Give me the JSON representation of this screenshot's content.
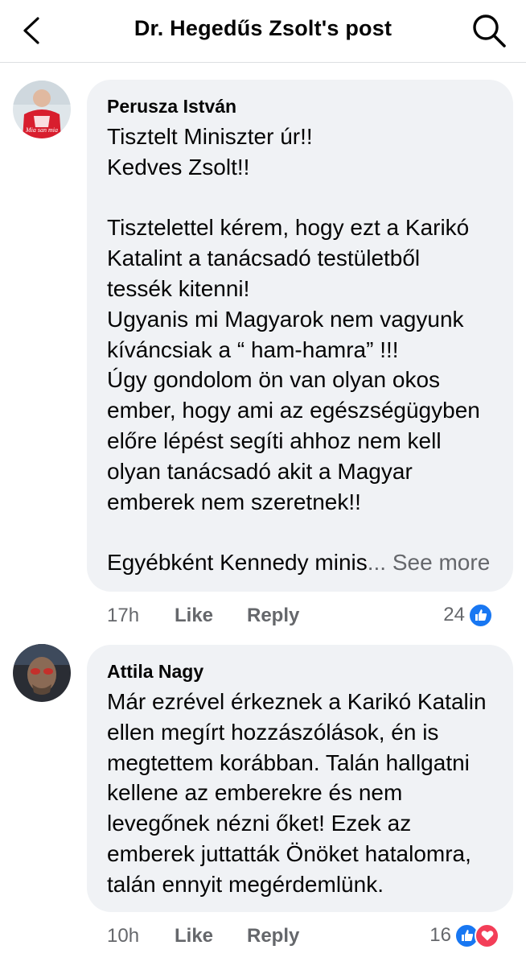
{
  "header": {
    "title": "Dr. Hegedűs Zsolt's post"
  },
  "comments": [
    {
      "author": "Perusza István",
      "text": "Tisztelt Miniszter úr!!\nKedves Zsolt!!\n\nTisztelettel kérem, hogy ezt a Karikó\nKatalint a tanácsadó testületből\ntessék kitenni!\nUgyanis mi Magyarok nem vagyunk\nkíváncsiak a “ ham-hamra” !!!\nÚgy gondolom ön van olyan okos\nember, hogy ami az egészségügyben\nelőre lépést segíti ahhoz nem kell\nolyan tanácsadó akit a Magyar\nemberek nem szeretnek!!\n\nEgyébként Kennedy minis",
      "ellipsis": "...",
      "see_more": "See more",
      "time": "17h",
      "like_label": "Like",
      "reply_label": "Reply",
      "reaction_count": "24",
      "reactions": [
        "like-icon"
      ],
      "avatar_caption": "Mia san mia"
    },
    {
      "author": "Attila Nagy",
      "text": "Már ezrével érkeznek a Karikó Katalin\nellen megírt hozzászólások, én is\nmegtettem korábban. Talán hallgatni\nkellene az emberekre és nem\nlevegőnek nézni őket! Ezek az\nemberek juttatták Önöket hatalomra,\ntalán ennyit megérdemlünk.",
      "time": "10h",
      "like_label": "Like",
      "reply_label": "Reply",
      "reaction_count": "16",
      "reactions": [
        "like-icon",
        "love-icon"
      ]
    }
  ],
  "colors": {
    "bubble_bg": "#f0f2f5",
    "meta_text": "#65676b",
    "like_blue": "#1877f2",
    "love_red": "#f33e58"
  }
}
